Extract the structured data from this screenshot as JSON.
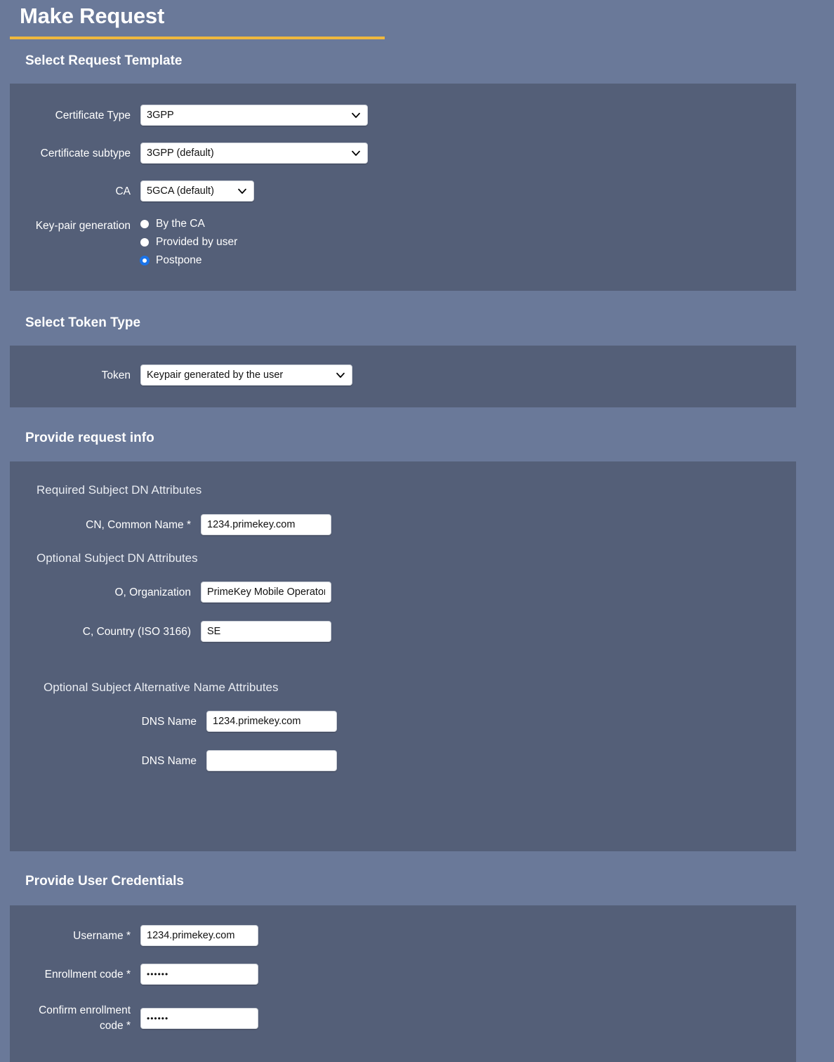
{
  "page": {
    "title": "Make Request"
  },
  "sections": {
    "template": {
      "heading": "Select Request Template",
      "certificate_type": {
        "label": "Certificate Type",
        "value": "3GPP",
        "icon": "chevron-down-icon"
      },
      "certificate_subtype": {
        "label": "Certificate subtype",
        "value": "3GPP (default)",
        "icon": "chevron-down-icon"
      },
      "ca": {
        "label": "CA",
        "value": "5GCA (default)",
        "icon": "chevron-down-icon"
      },
      "key_pair_generation": {
        "label": "Key-pair generation",
        "options": [
          {
            "label": "By the CA",
            "selected": false
          },
          {
            "label": "Provided by user",
            "selected": false
          },
          {
            "label": "Postpone",
            "selected": true
          }
        ]
      }
    },
    "token": {
      "heading": "Select Token Type",
      "token": {
        "label": "Token",
        "value": "Keypair generated by the user",
        "icon": "chevron-down-icon"
      }
    },
    "request_info": {
      "heading": "Provide request info",
      "required_dn_heading": "Required Subject DN Attributes",
      "optional_dn_heading": "Optional Subject DN Attributes",
      "optional_san_heading": "Optional Subject Alternative Name Attributes",
      "fields": {
        "common_name": {
          "label": "CN, Common Name *",
          "value": "1234.primekey.com"
        },
        "organization": {
          "label": "O, Organization",
          "value": "PrimeKey Mobile Operator"
        },
        "country": {
          "label": "C, Country (ISO 3166)",
          "value": "SE"
        },
        "dns_name_1": {
          "label": "DNS Name",
          "value": "1234.primekey.com"
        },
        "dns_name_2": {
          "label": "DNS Name",
          "value": ""
        }
      }
    },
    "credentials": {
      "heading": "Provide User Credentials",
      "username": {
        "label": "Username *",
        "value": "1234.primekey.com"
      },
      "enrollment_code": {
        "label": "Enrollment code *",
        "value": "••••••"
      },
      "confirm_enrollment_code": {
        "label": "Confirm enrollment code *",
        "label_line1": "Confirm enrollment",
        "label_line2": "code *",
        "value": "••••••"
      }
    }
  },
  "colors": {
    "page_background": "#6a7999",
    "panel_background": "#545f78",
    "accent_rule": "#efb83e",
    "radio_selected": "#1a73e8",
    "control_background": "#ffffff",
    "text": "#ffffff"
  }
}
